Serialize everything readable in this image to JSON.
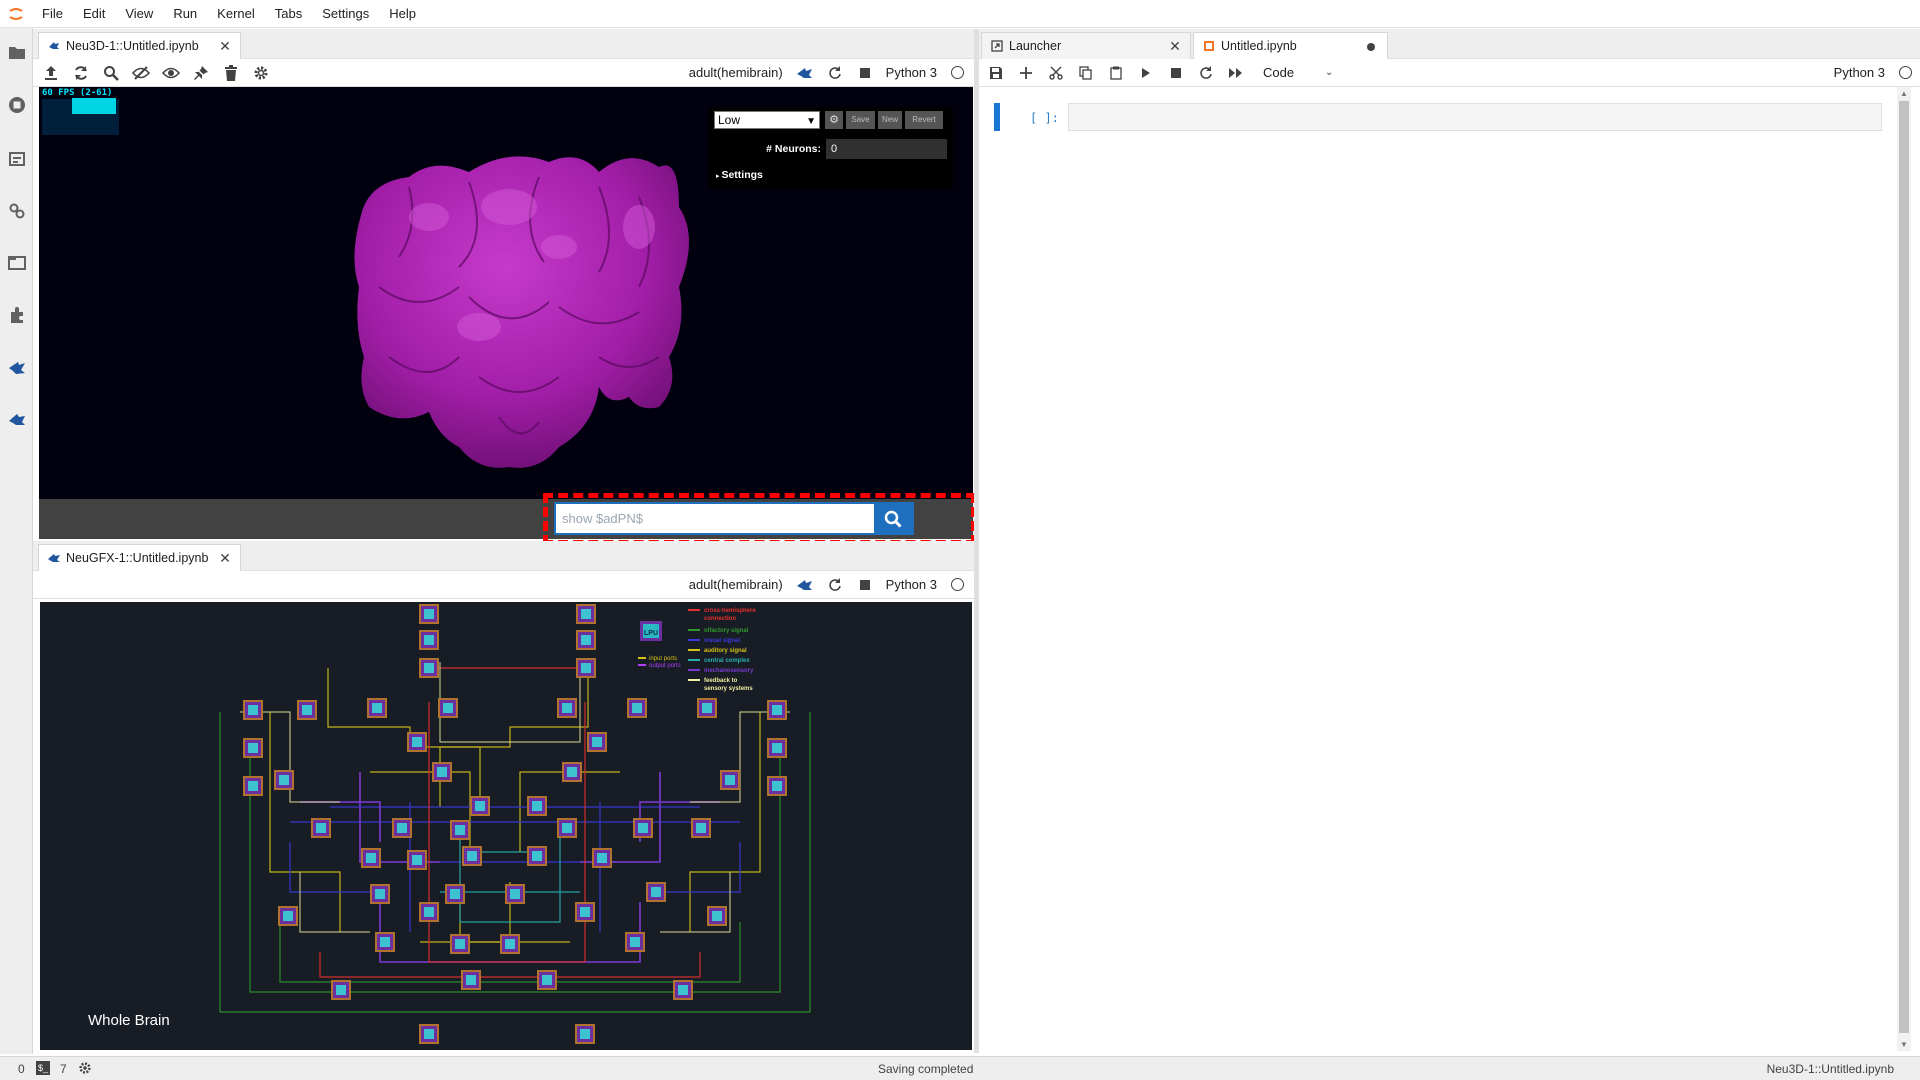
{
  "menubar": {
    "items": [
      "File",
      "Edit",
      "View",
      "Run",
      "Kernel",
      "Tabs",
      "Settings",
      "Help"
    ]
  },
  "sidebar": {
    "icons": [
      "folder-icon",
      "running-icon",
      "commands-icon",
      "property-inspector-icon",
      "tabs-icon",
      "extensions-icon",
      "fbl-icon",
      "neu3d-icon"
    ]
  },
  "neu3d_panel": {
    "tab_title": "Neu3D-1::Untitled.ipynb",
    "dataset": "adult(hemibrain)",
    "kernel": "Python 3",
    "fps": "60 FPS (2-61)",
    "gui": {
      "quality": "Low",
      "save_label": "Save",
      "new_label": "New",
      "revert_label": "Revert",
      "neurons_label": "# Neurons:",
      "neurons_value": "0",
      "settings_label": "Settings"
    },
    "search": {
      "value": "show $adPN$"
    },
    "mesh_color": "#a21ea8"
  },
  "neugfx_panel": {
    "tab_title": "NeuGFX-1::Untitled.ipynb",
    "dataset": "adult(hemibrain)",
    "kernel": "Python 3",
    "caption": "Whole Brain",
    "legend": [
      {
        "label": "cross-hemisphere connection",
        "color": "#e83030"
      },
      {
        "label": "olfactory signal",
        "color": "#2e9a2e"
      },
      {
        "label": "visual signal",
        "color": "#3a3ae0"
      },
      {
        "label": "auditory signal",
        "color": "#d4c21a"
      },
      {
        "label": "central complex",
        "color": "#27b0b0"
      },
      {
        "label": "mechanosensory",
        "color": "#7a3ad0"
      },
      {
        "label": "feedback to sensory systems",
        "color": "#f0f0a0"
      }
    ],
    "port_legend": {
      "badge": "LPU",
      "input_ports": "input ports",
      "output_ports": "output ports"
    }
  },
  "notebook_panel": {
    "tabs": [
      {
        "title": "Launcher",
        "active": false
      },
      {
        "title": "Untitled.ipynb",
        "active": true
      }
    ],
    "cell_type": "Code",
    "kernel": "Python 3",
    "cell_prompt": "[ ]:"
  },
  "statusbar": {
    "left_count": "0",
    "terminals": "7",
    "status": "Saving completed",
    "active_doc": "Neu3D-1::Untitled.ipynb"
  }
}
